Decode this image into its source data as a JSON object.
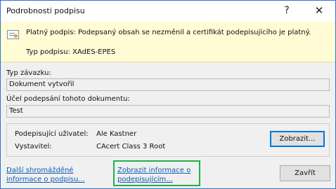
{
  "window": {
    "title": "Podrobnosti podpisu",
    "help_glyph": "?",
    "close_glyph": "✕"
  },
  "banner": {
    "status": "Platný podpis: Podepsaný obsah se nezměnil a certifikát podepisujícího je platný.",
    "signature_type_label": "Typ podpisu:",
    "signature_type_value": "XAdES-EPES",
    "icon": "certificate-icon"
  },
  "commitment": {
    "label": "Typ závazku:",
    "value": "Dokument vytvořil"
  },
  "purpose": {
    "label": "Účel podepsání tohoto dokumentu:",
    "value": "Test"
  },
  "signer": {
    "user_label": "Podepisující uživatel:",
    "user_value": "Ale Kastner",
    "issuer_label": "Vystavitel:",
    "issuer_value": "CAcert Class 3 Root",
    "view_button": "Zobrazit..."
  },
  "footer": {
    "more_info_line1": "Další shromážděné",
    "more_info_line2": "informace o podpisu...",
    "signer_info_line1": "Zobrazit informace o",
    "signer_info_line2": "podepisujícím...",
    "close_button": "Zavřít"
  },
  "colors": {
    "banner_bg": "#fffcd6",
    "link": "#0b5db3",
    "highlight": "#21b14a",
    "focus": "#0078d7"
  }
}
